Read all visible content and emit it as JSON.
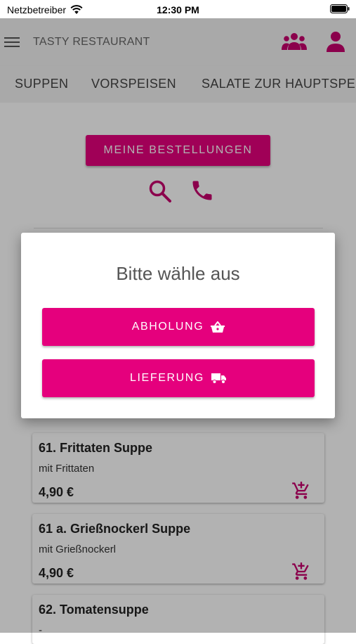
{
  "status_bar": {
    "carrier": "Netzbetreiber",
    "time": "12:30 PM"
  },
  "app_bar": {
    "title": "TASTY RESTAURANT"
  },
  "tabs": [
    {
      "label": "SUPPEN"
    },
    {
      "label": "VORSPEISEN"
    },
    {
      "label": "SALATE ZUR HAUPTSPEISE"
    }
  ],
  "main": {
    "orders_button": "MEINE BESTELLUNGEN"
  },
  "menu_items": [
    {
      "name": "61. Frittaten Suppe",
      "description": "mit Frittaten",
      "price": "4,90 €"
    },
    {
      "name": "61 a. Grießnockerl Suppe",
      "description": "mit Grießnockerl",
      "price": "4,90 €"
    },
    {
      "name": "62. Tomatensuppe",
      "description": "-",
      "price": ""
    }
  ],
  "dialog": {
    "title": "Bitte wähle aus",
    "pickup_label": "ABHOLUNG",
    "delivery_label": "LIEFERUNG"
  },
  "colors": {
    "accent": "#e5007d",
    "appbar_bg": "#f3f3f3"
  },
  "icons": [
    "wifi-icon",
    "battery-icon",
    "menu-icon",
    "group-icon",
    "user-icon",
    "search-icon",
    "phone-icon",
    "add-to-cart-icon",
    "basket-icon",
    "truck-icon"
  ]
}
